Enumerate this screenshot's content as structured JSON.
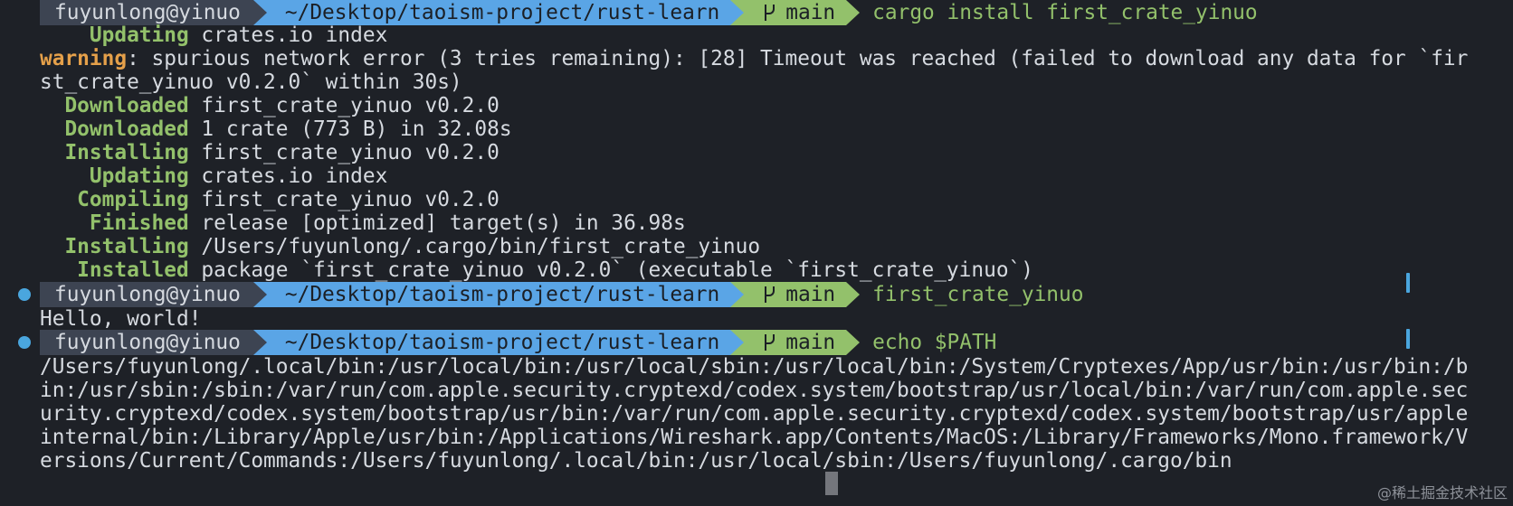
{
  "prompt": {
    "user": "fuyunlong@yinuo",
    "path": "~/Desktop/taoism-project/rust-learn",
    "branch": "main"
  },
  "commands": [
    "cargo install first_crate_yinuo",
    "first_crate_yinuo",
    "echo $PATH"
  ],
  "install_output": [
    {
      "label": "    Updating",
      "text": " crates.io index"
    },
    {
      "label": "warning",
      "text": ": spurious network error (3 tries remaining): [28] Timeout was reached (failed to download any data for `fir",
      "kind": "warn"
    },
    {
      "label": "",
      "text": "st_crate_yinuo v0.2.0` within 30s)"
    },
    {
      "label": "  Downloaded",
      "text": " first_crate_yinuo v0.2.0"
    },
    {
      "label": "  Downloaded",
      "text": " 1 crate (773 B) in 32.08s"
    },
    {
      "label": "  Installing",
      "text": " first_crate_yinuo v0.2.0"
    },
    {
      "label": "    Updating",
      "text": " crates.io index"
    },
    {
      "label": "   Compiling",
      "text": " first_crate_yinuo v0.2.0"
    },
    {
      "label": "    Finished",
      "text": " release [optimized] target(s) in 36.98s"
    },
    {
      "label": "  Installing",
      "text": " /Users/fuyunlong/.cargo/bin/first_crate_yinuo"
    },
    {
      "label": "   Installed",
      "text": " package `first_crate_yinuo v0.2.0` (executable `first_crate_yinuo`)"
    }
  ],
  "hello_output": "Hello, world!",
  "path_output": [
    "/Users/fuyunlong/.local/bin:/usr/local/bin:/usr/local/sbin:/usr/local/bin:/System/Cryptexes/App/usr/bin:/usr/bin:/b",
    "in:/usr/sbin:/sbin:/var/run/com.apple.security.cryptexd/codex.system/bootstrap/usr/local/bin:/var/run/com.apple.sec",
    "urity.cryptexd/codex.system/bootstrap/usr/bin:/var/run/com.apple.security.cryptexd/codex.system/bootstrap/usr/apple",
    "internal/bin:/Library/Apple/usr/bin:/Applications/Wireshark.app/Contents/MacOS:/Library/Frameworks/Mono.framework/V",
    "ersions/Current/Commands:/Users/fuyunlong/.local/bin:/usr/local/sbin:/Users/fuyunlong/.cargo/bin"
  ],
  "watermark": "@稀土掘金技术社区",
  "colors": {
    "background": "#1e2127",
    "user_segment": "#3d4452",
    "path_segment": "#5aa5e6",
    "git_segment": "#93c16b",
    "label_green": "#93c16b",
    "label_warning": "#e5a04a"
  },
  "icons": [
    "git-branch-icon",
    "status-dot-icon"
  ]
}
